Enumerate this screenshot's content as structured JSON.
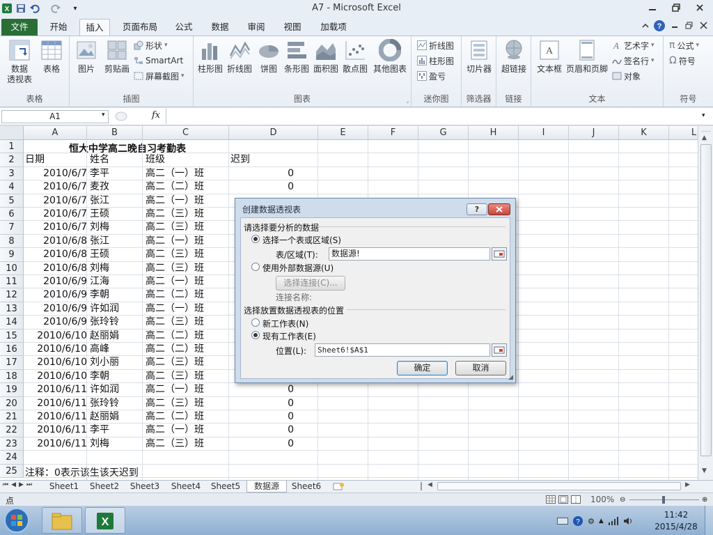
{
  "window": {
    "title": "A7  -  Microsoft Excel"
  },
  "menu": {
    "tabs": [
      "文件",
      "开始",
      "插入",
      "页面布局",
      "公式",
      "数据",
      "审阅",
      "视图",
      "加载项"
    ],
    "active": "插入"
  },
  "ribbon": {
    "groups": {
      "tables": {
        "label": "表格",
        "pivot": "数据\n透视表",
        "table": "表格"
      },
      "illustrations": {
        "label": "插图",
        "picture": "图片",
        "clipart": "剪贴画",
        "shapes": "形状",
        "smartart": "SmartArt",
        "screenshot": "屏幕截图"
      },
      "charts": {
        "label": "图表",
        "items": [
          "柱形图",
          "折线图",
          "饼图",
          "条形图",
          "面积图",
          "散点图",
          "其他图表"
        ]
      },
      "sparklines": {
        "label": "迷你图",
        "items": [
          "折线图",
          "柱形图",
          "盈亏"
        ]
      },
      "filter": {
        "label": "筛选器",
        "item": "切片器"
      },
      "links": {
        "label": "链接",
        "item": "超链接"
      },
      "text": {
        "label": "文本",
        "textbox": "文本框",
        "header": "页眉和页脚",
        "wordart": "艺术字",
        "signature": "签名行",
        "object": "对象"
      },
      "symbols": {
        "label": "符号",
        "formula": "公式",
        "symbol": "符号"
      }
    }
  },
  "formula_bar": {
    "namebox": "A1",
    "fx": "fx"
  },
  "columns": [
    "A",
    "B",
    "C",
    "D",
    "E",
    "F",
    "G",
    "H",
    "I",
    "J",
    "K",
    "L"
  ],
  "rows": [
    {
      "n": "1",
      "a": "",
      "b": "",
      "c": "",
      "d": ""
    },
    {
      "n": "2",
      "a": "日期",
      "b": "姓名",
      "c": "班级",
      "d": "迟到"
    },
    {
      "n": "3",
      "a": "2010/6/7",
      "b": "李平",
      "c": "高二（一）班",
      "d": "0"
    },
    {
      "n": "4",
      "a": "2010/6/7",
      "b": "麦孜",
      "c": "高二（二）班",
      "d": "0"
    },
    {
      "n": "5",
      "a": "2010/6/7",
      "b": "张江",
      "c": "高二（一）班",
      "d": ""
    },
    {
      "n": "6",
      "a": "2010/6/7",
      "b": "王硕",
      "c": "高二（三）班",
      "d": ""
    },
    {
      "n": "7",
      "a": "2010/6/7",
      "b": "刘梅",
      "c": "高二（三）班",
      "d": ""
    },
    {
      "n": "8",
      "a": "2010/6/8",
      "b": "张江",
      "c": "高二（一）班",
      "d": ""
    },
    {
      "n": "9",
      "a": "2010/6/8",
      "b": "王硕",
      "c": "高二（三）班",
      "d": ""
    },
    {
      "n": "10",
      "a": "2010/6/8",
      "b": "刘梅",
      "c": "高二（三）班",
      "d": ""
    },
    {
      "n": "11",
      "a": "2010/6/9",
      "b": "江海",
      "c": "高二（一）班",
      "d": ""
    },
    {
      "n": "12",
      "a": "2010/6/9",
      "b": "李朝",
      "c": "高二（二）班",
      "d": ""
    },
    {
      "n": "13",
      "a": "2010/6/9",
      "b": "许如润",
      "c": "高二（一）班",
      "d": ""
    },
    {
      "n": "14",
      "a": "2010/6/9",
      "b": "张玲铃",
      "c": "高二（三）班",
      "d": ""
    },
    {
      "n": "15",
      "a": "2010/6/10",
      "b": "赵丽娟",
      "c": "高二（二）班",
      "d": ""
    },
    {
      "n": "16",
      "a": "2010/6/10",
      "b": "高峰",
      "c": "高二（二）班",
      "d": ""
    },
    {
      "n": "17",
      "a": "2010/6/10",
      "b": "刘小丽",
      "c": "高二（三）班",
      "d": ""
    },
    {
      "n": "18",
      "a": "2010/6/10",
      "b": "李朝",
      "c": "高二（三）班",
      "d": ""
    },
    {
      "n": "19",
      "a": "2010/6/11",
      "b": "许如润",
      "c": "高二（一）班",
      "d": "0"
    },
    {
      "n": "20",
      "a": "2010/6/11",
      "b": "张玲铃",
      "c": "高二（三）班",
      "d": "0"
    },
    {
      "n": "21",
      "a": "2010/6/11",
      "b": "赵丽娟",
      "c": "高二（二）班",
      "d": "0"
    },
    {
      "n": "22",
      "a": "2010/6/11",
      "b": "李平",
      "c": "高二（一）班",
      "d": "0"
    },
    {
      "n": "23",
      "a": "2010/6/11",
      "b": "刘梅",
      "c": "高二（三）班",
      "d": "0"
    },
    {
      "n": "24",
      "a": "",
      "b": "",
      "c": "",
      "d": ""
    },
    {
      "n": "25",
      "a": "",
      "b": "",
      "c": "",
      "d": ""
    }
  ],
  "sheet_title": "恒大中学高二晚自习考勤表",
  "note": "注释：0表示该生该天迟到",
  "sheets": [
    "Sheet1",
    "Sheet2",
    "Sheet3",
    "Sheet4",
    "Sheet5",
    "数据源",
    "Sheet6"
  ],
  "active_sheet": "数据源",
  "status": {
    "mode": "点",
    "zoom": "100%"
  },
  "taskbar": {
    "time": "11:42",
    "date": "2015/4/28"
  },
  "dialog": {
    "title": "创建数据透视表",
    "section1": "请选择要分析的数据",
    "opt_range": "选择一个表或区域(S)",
    "range_label": "表/区域(T):",
    "range_value": "数据源!",
    "opt_external": "使用外部数据源(U)",
    "choose_conn": "选择连接(C)...",
    "conn_name": "连接名称:",
    "section2": "选择放置数据透视表的位置",
    "opt_new": "新工作表(N)",
    "opt_existing": "现有工作表(E)",
    "loc_label": "位置(L):",
    "loc_value": "Sheet6!$A$1",
    "ok": "确定",
    "cancel": "取消"
  },
  "colors": {
    "file_tab": "#2a6e36",
    "dialog_frame": "#cfdcec",
    "close_red": "#c9463d"
  }
}
